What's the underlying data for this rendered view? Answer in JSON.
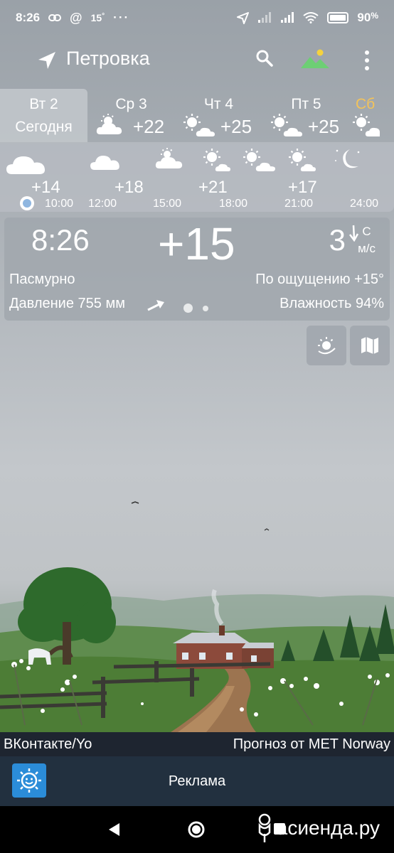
{
  "status_bar": {
    "time": "8:26",
    "temp": "15",
    "battery": "90"
  },
  "toolbar": {
    "city": "Петровка"
  },
  "days": [
    {
      "name": "Вт 2",
      "sub": "Сегодня",
      "temp": "",
      "icon": "cloud-icon",
      "selected": true
    },
    {
      "name": "Ср 3",
      "sub": "",
      "temp": "+22",
      "icon": "sun-cloud-icon"
    },
    {
      "name": "Чт 4",
      "sub": "",
      "temp": "+25",
      "icon": "sun-cloud-icon"
    },
    {
      "name": "Пт 5",
      "sub": "",
      "temp": "+25",
      "icon": "sun-cloud-icon"
    },
    {
      "name": "Сб",
      "sub": "",
      "temp": "",
      "icon": "sun-cloud-icon",
      "accent": "#f3c35a"
    }
  ],
  "hourly": {
    "temps": [
      "+14",
      "+18",
      "+21",
      "+17"
    ],
    "times": [
      "10:00",
      "12:00",
      "15:00",
      "18:00",
      "21:00",
      "24:00"
    ]
  },
  "current": {
    "time": "8:26",
    "temp": "+15",
    "wind_speed": "3",
    "wind_dir": "С",
    "wind_unit": "м/с",
    "condition": "Пасмурно",
    "feels_like": "По ощущению +15°",
    "pressure": "Давление 755 мм",
    "humidity": "Влажность 94%"
  },
  "footer": {
    "left": "ВКонтакте/Yo",
    "right": "Прогноз от MET Norway"
  },
  "ad": {
    "label": "Реклама"
  },
  "watermark": {
    "text": "асиенда.ру"
  },
  "colors": {
    "accent": "#f3c35a",
    "ad_bg": "#22303f",
    "logo": "#2b8cd8"
  }
}
